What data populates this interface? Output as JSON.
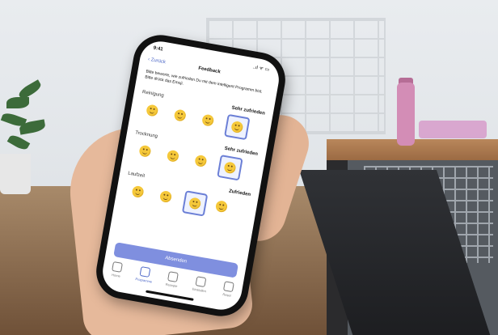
{
  "status": {
    "time": "9:41",
    "indicators": "..ıl ᯤ ▭"
  },
  "nav": {
    "back_label": "Zurück",
    "title": "Feedback"
  },
  "instruction": "Bitte bewerte, wie zufrieden Du mit dem intelligent Programm bist. Bitte drück das Emoji.",
  "sections": [
    {
      "label": "Reinigung",
      "rating": "Sehr zufrieden",
      "selected_index": 3
    },
    {
      "label": "Trocknung",
      "rating": "Sehr zufrieden",
      "selected_index": 3
    },
    {
      "label": "Laufzeit",
      "rating": "Zufrieden",
      "selected_index": 2
    }
  ],
  "submit_label": "Absenden",
  "tabs": [
    {
      "label": "Home",
      "icon": "home-icon"
    },
    {
      "label": "Programme",
      "icon": "programs-icon",
      "active": true
    },
    {
      "label": "Rezepte",
      "icon": "recipes-icon"
    },
    {
      "label": "Einstellen",
      "icon": "settings-icon"
    },
    {
      "label": "Reset",
      "icon": "reset-icon"
    }
  ],
  "colors": {
    "accent": "#4c67c7",
    "button": "#7f8fdf",
    "emoji": "#f5c83a"
  }
}
